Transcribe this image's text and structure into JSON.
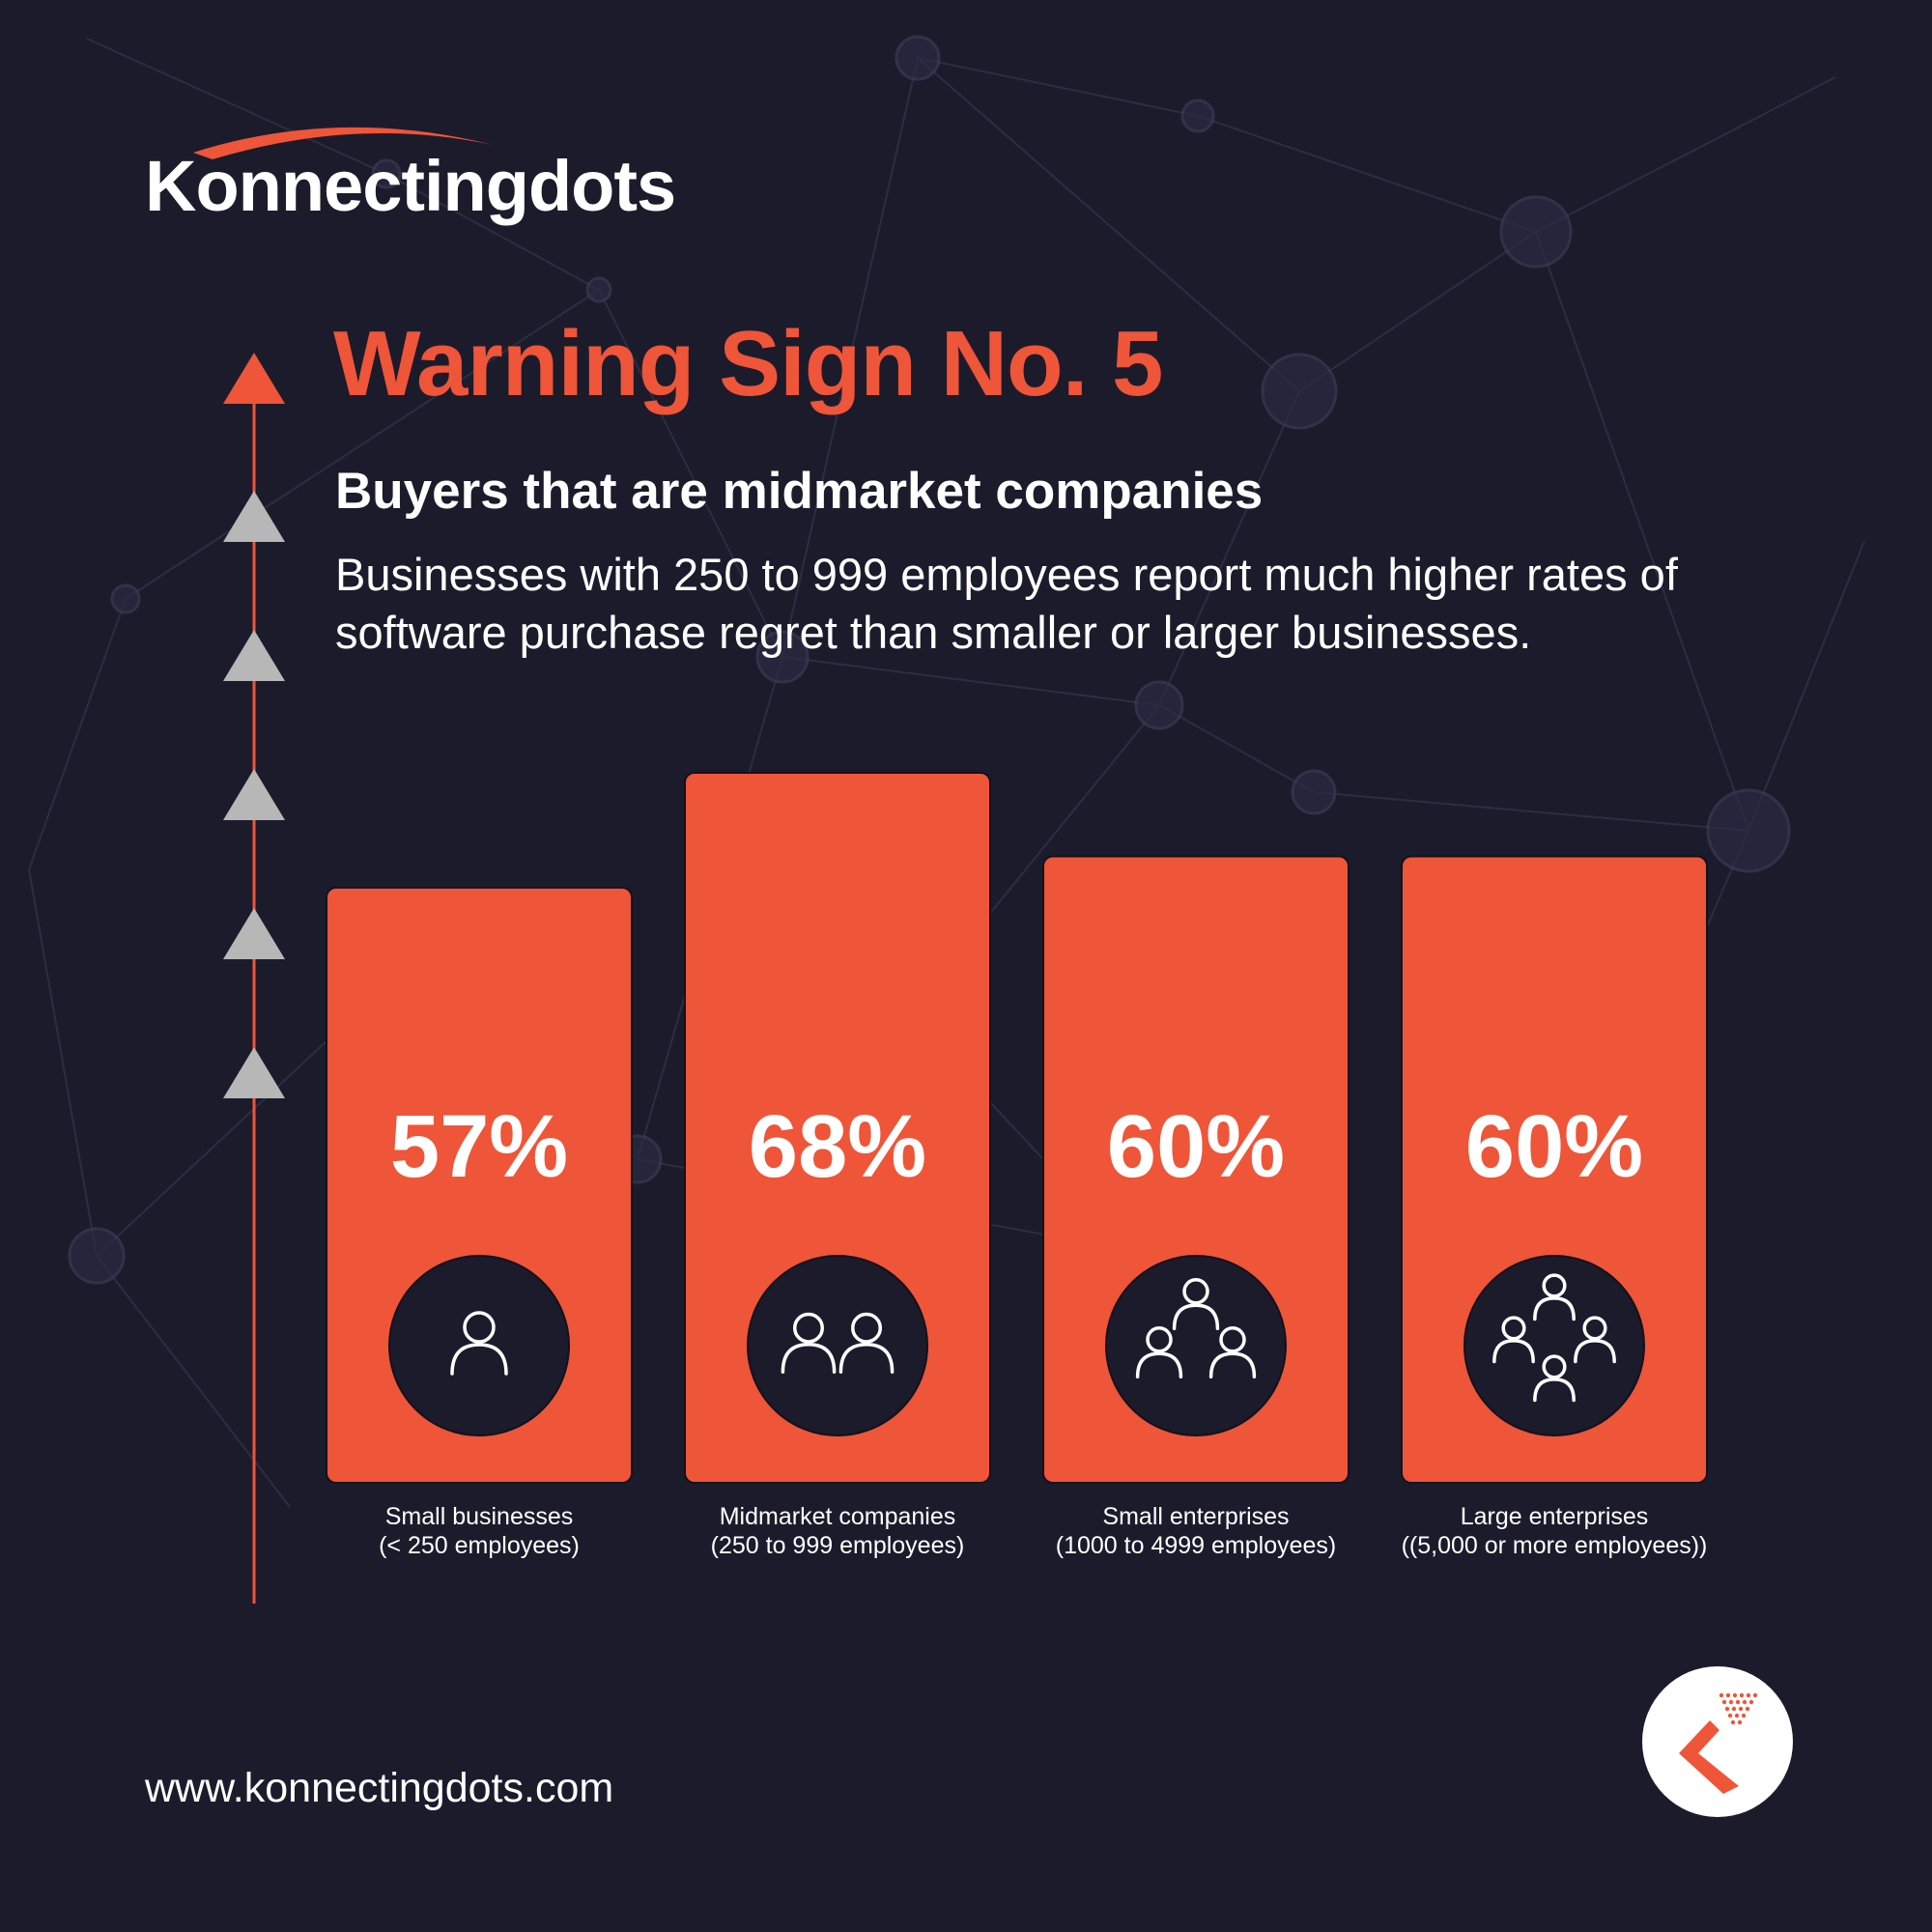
{
  "brand": {
    "logo_text": "Konnectingdots",
    "url": "www.konnectingdots.com",
    "accent_color": "#ef5538",
    "background_color": "#1c1b2c"
  },
  "header": {
    "title": "Warning Sign No. 5",
    "subtitle": "Buyers that are midmarket companies",
    "description": "Businesses with 250 to 999 employees report much higher rates of software purchase regret than smaller or larger businesses."
  },
  "chart_data": {
    "type": "bar",
    "categories": [
      "Small businesses (< 250 employees)",
      "Midmarket companies (250 to 999 employees)",
      "Small enterprises (1000 to 4999 employees)",
      "Large enterprises ((5,000 or more employees))"
    ],
    "values": [
      57,
      68,
      60,
      60
    ],
    "value_labels": [
      "57%",
      "68%",
      "60%",
      "60%"
    ],
    "label_lines": [
      [
        "Small businesses",
        "(< 250 employees)"
      ],
      [
        "Midmarket companies",
        "(250 to 999 employees)"
      ],
      [
        "Small enterprises",
        "(1000 to 4999 employees)"
      ],
      [
        "Large enterprises",
        "((5,000 or more employees))"
      ]
    ],
    "icons": [
      "person-icon",
      "two-people-icon",
      "three-people-icon",
      "four-people-icon"
    ],
    "people_counts": [
      1,
      2,
      3,
      4
    ],
    "bar_color": "#ef5538",
    "icon_circle_color": "#1c1b2c"
  }
}
